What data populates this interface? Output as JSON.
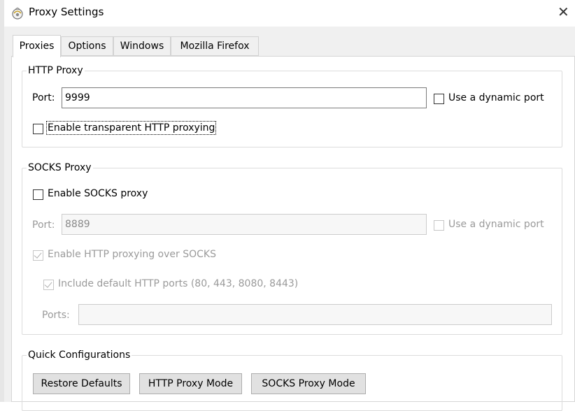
{
  "window": {
    "title": "Proxy Settings",
    "close_glyph": "✕",
    "icon": "proxy-app-icon"
  },
  "tabs": [
    {
      "label": "Proxies",
      "active": true
    },
    {
      "label": "Options",
      "active": false
    },
    {
      "label": "Windows",
      "active": false
    },
    {
      "label": "Mozilla Firefox",
      "active": false
    }
  ],
  "http_proxy": {
    "legend": "HTTP Proxy",
    "port_label": "Port:",
    "port_value": "9999",
    "dynamic_port_label": "Use a dynamic port",
    "dynamic_port_checked": false,
    "transparent_label": "Enable transparent HTTP proxying",
    "transparent_checked": false
  },
  "socks_proxy": {
    "legend": "SOCKS Proxy",
    "enable_label": "Enable SOCKS proxy",
    "enable_checked": false,
    "port_label": "Port:",
    "port_value": "8889",
    "dynamic_port_label": "Use a dynamic port",
    "dynamic_port_checked": false,
    "http_over_socks_label": "Enable HTTP proxying over SOCKS",
    "http_over_socks_checked": true,
    "include_default_ports_label": "Include default HTTP ports (80, 443, 8080, 8443)",
    "include_default_ports_checked": true,
    "ports_label": "Ports:",
    "ports_value": ""
  },
  "quick_config": {
    "legend": "Quick Configurations",
    "buttons": [
      "Restore Defaults",
      "HTTP Proxy Mode",
      "SOCKS Proxy Mode"
    ]
  }
}
